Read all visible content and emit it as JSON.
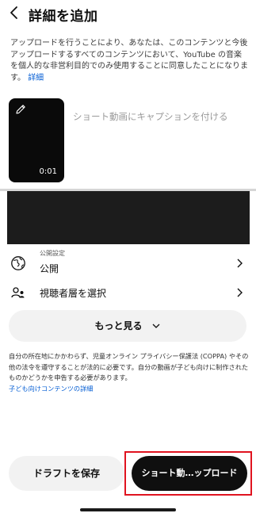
{
  "header": {
    "title": "詳細を追加"
  },
  "notice": {
    "text": "アップロードを行うことにより、あなたは、このコンテンツと今後アップロードするすべてのコンテンツにおいて、YouTube の音楽を個人的な非営利目的でのみ使用することに同意したことになります。",
    "link": "詳細"
  },
  "thumbnail": {
    "duration": "0:01"
  },
  "caption": {
    "placeholder": "ショート動画にキャプションを付ける"
  },
  "visibility": {
    "small_label": "公開設定",
    "value": "公開"
  },
  "audience": {
    "label": "視聴者層を選択"
  },
  "show_more": {
    "label": "もっと見る"
  },
  "legal": {
    "text": "自分の所在地にかかわらず、児童オンライン プライバシー保護法 (COPPA) やその他の法令を遵守することが法的に必要です。自分の動画が子ども向けに制作されたものかどうかを申告する必要があります。",
    "link": "子ども向けコンテンツの詳細"
  },
  "footer": {
    "draft_label": "ドラフトを保存",
    "upload_label": "ショート動…ップロード"
  },
  "colors": {
    "accent_link": "#065fd4",
    "highlight_outline": "#e0131f",
    "primary_button": "#0f0f0f",
    "secondary_button": "#f2f2f2"
  }
}
